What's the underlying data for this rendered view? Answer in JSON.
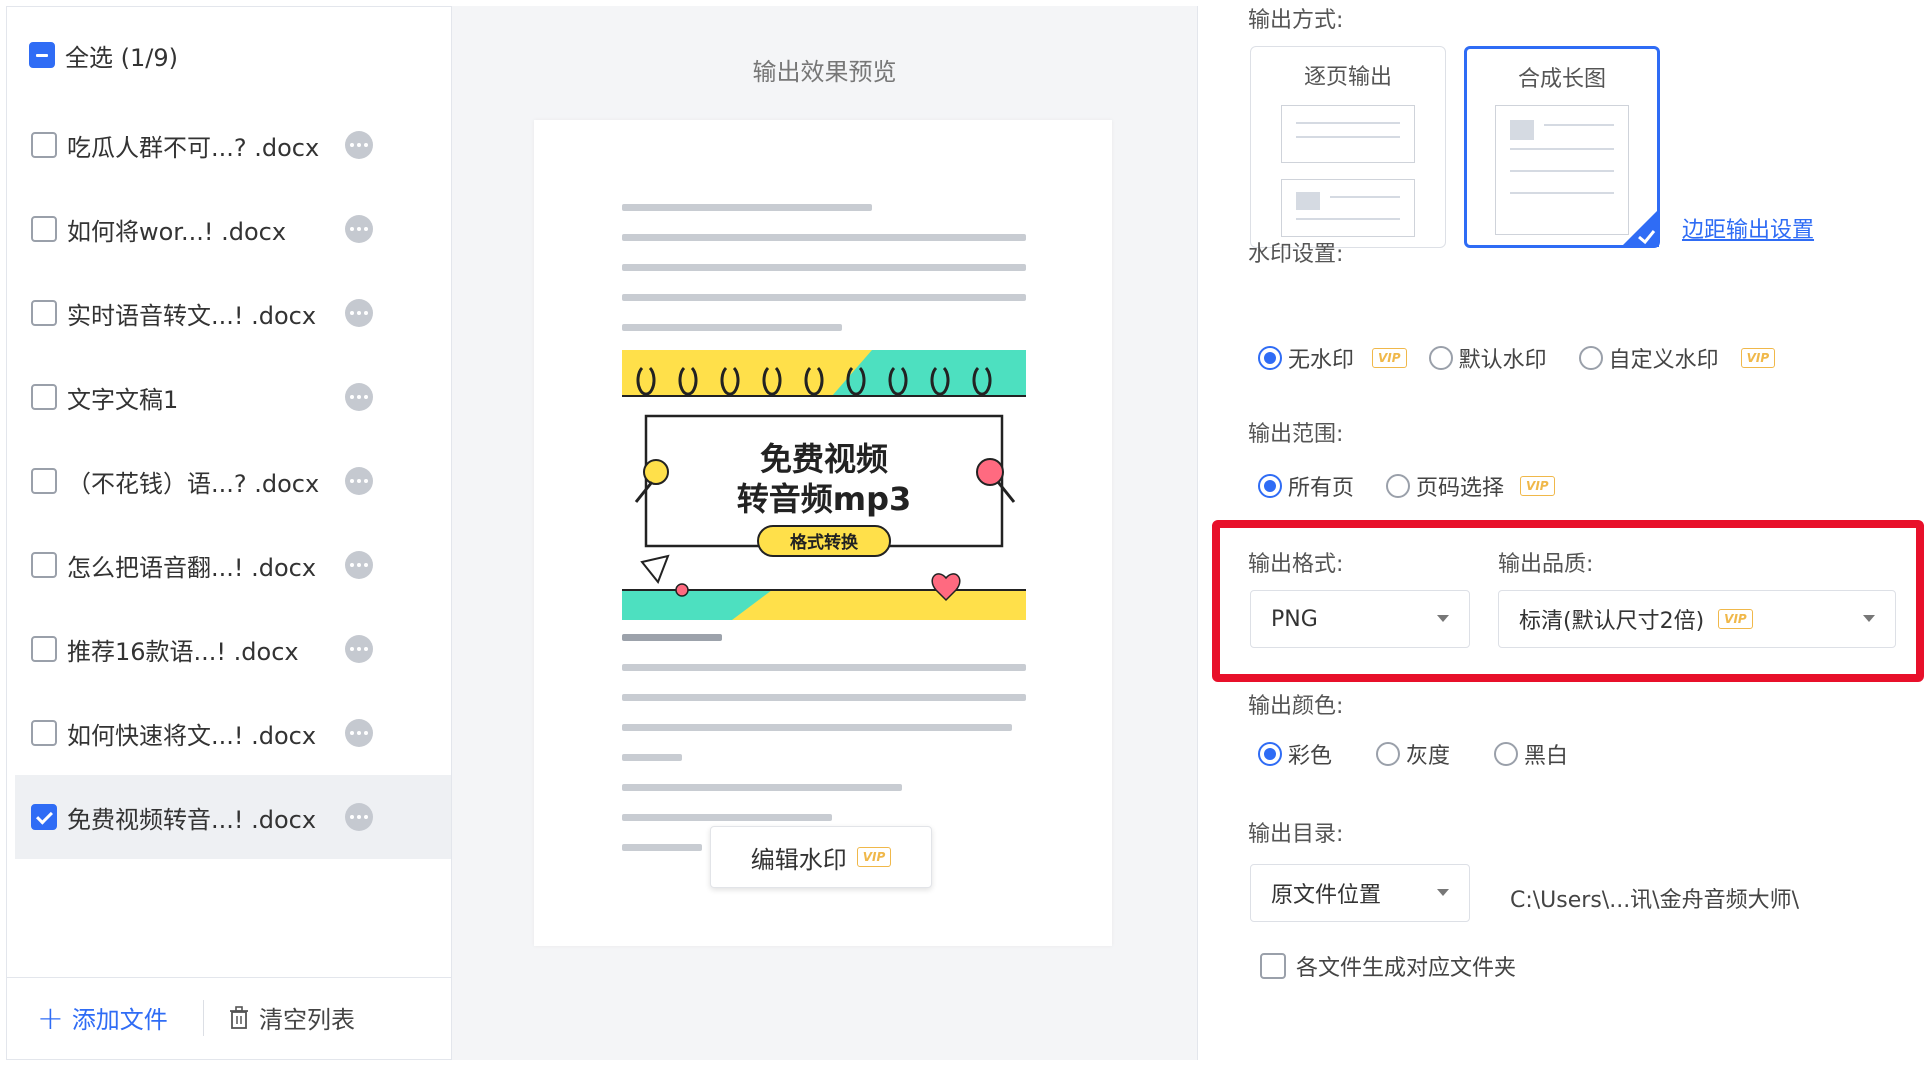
{
  "file_panel": {
    "select_all_label": "全选 (1/9)",
    "files": [
      {
        "name": "吃瓜人群不可...? .docx",
        "checked": false
      },
      {
        "name": "如何将wor...! .docx",
        "checked": false
      },
      {
        "name": "实时语音转文...! .docx",
        "checked": false
      },
      {
        "name": "文字文稿1",
        "checked": false
      },
      {
        "name": "（不花钱）语...? .docx",
        "checked": false
      },
      {
        "name": "怎么把语音翻...! .docx",
        "checked": false
      },
      {
        "name": "推荐16款语...! .docx",
        "checked": false
      },
      {
        "name": "如何快速将文...! .docx",
        "checked": false
      },
      {
        "name": "免费视频转音...! .docx",
        "checked": true
      }
    ],
    "add_file_label": "添加文件",
    "clear_list_label": "清空列表"
  },
  "preview": {
    "title": "输出效果预览",
    "banner_line1": "免费视频",
    "banner_line2": "转音频mp3",
    "banner_tag": "格式转换",
    "edit_watermark_label": "编辑水印",
    "vip_badge": "VIP"
  },
  "settings": {
    "output_mode_label": "输出方式:",
    "mode_per_page": "逐页输出",
    "mode_long_image": "合成长图",
    "margin_link": "边距输出设置",
    "watermark_label": "水印设置:",
    "watermark_options": [
      "无水印",
      "默认水印",
      "自定义水印"
    ],
    "range_label": "输出范围:",
    "range_options": [
      "所有页",
      "页码选择"
    ],
    "format_label": "输出格式:",
    "format_value": "PNG",
    "quality_label": "输出品质:",
    "quality_value": "标清(默认尺寸2倍)",
    "color_label": "输出颜色:",
    "color_options": [
      "彩色",
      "灰度",
      "黑白"
    ],
    "dir_label": "输出目录:",
    "dir_value": "原文件位置",
    "dir_path": "C:\\Users\\...讯\\金舟音频大师\\",
    "per_file_folder_label": "各文件生成对应文件夹",
    "vip_badge": "VIP"
  },
  "colors": {
    "accent": "#2f6cf5",
    "highlight_border": "#e8102a",
    "vip": "#f0b84a",
    "banner_yellow": "#ffe04a",
    "banner_teal": "#4de0c0"
  }
}
